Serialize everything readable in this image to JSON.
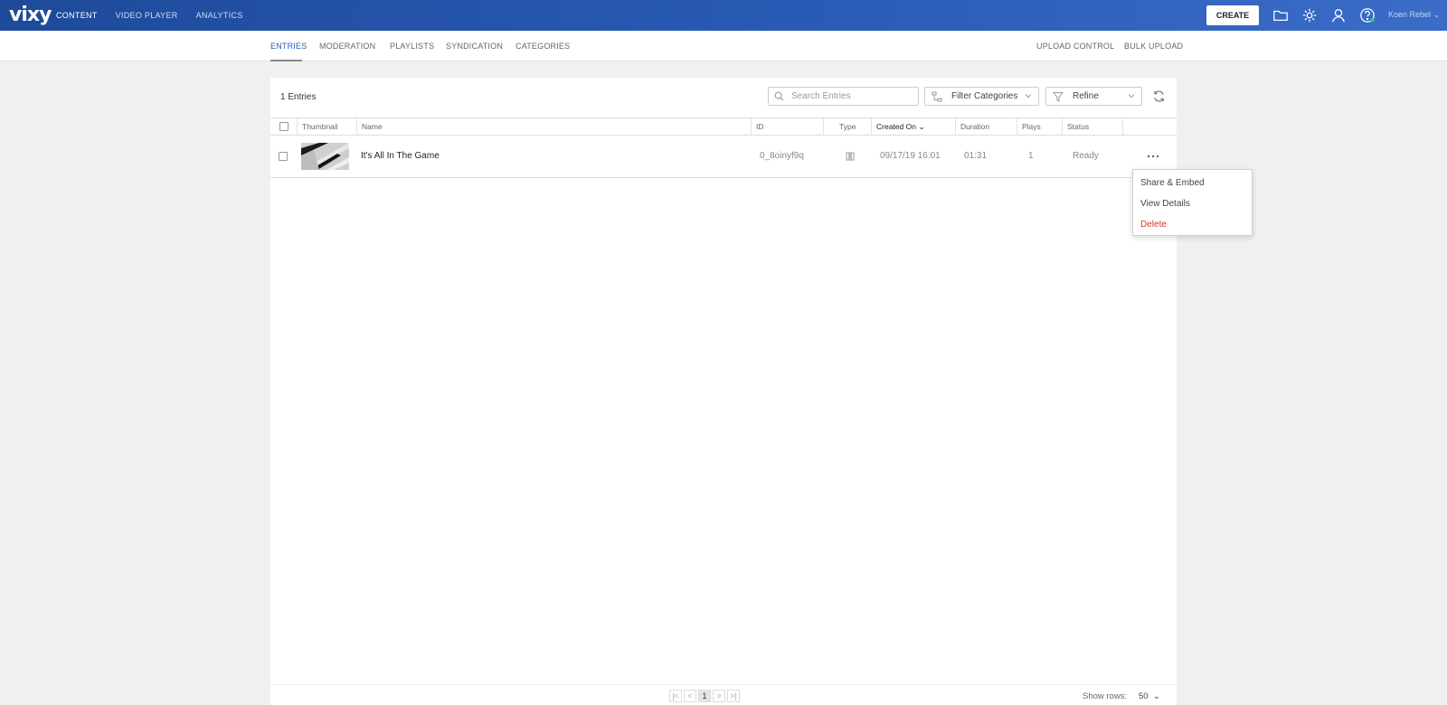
{
  "app": {
    "logo": "vixy"
  },
  "topnav": {
    "items": [
      {
        "label": "CONTENT",
        "active": true
      },
      {
        "label": "VIDEO PLAYER",
        "active": false
      },
      {
        "label": "ANALYTICS",
        "active": false
      }
    ]
  },
  "header": {
    "create_label": "CREATE",
    "user_name": "Koen Rebel"
  },
  "subnav": {
    "left": [
      "ENTRIES",
      "MODERATION",
      "PLAYLISTS",
      "SYNDICATION",
      "CATEGORIES"
    ],
    "right": [
      "UPLOAD CONTROL",
      "BULK UPLOAD"
    ]
  },
  "toolbar": {
    "entries_count": "1 Entries",
    "search_placeholder": "Search Entries",
    "filter_categories": "Filter Categories",
    "refine": "Refine"
  },
  "table": {
    "columns": [
      "Thumbnail",
      "Name",
      "ID",
      "Type",
      "Created On",
      "Duration",
      "Plays",
      "Status"
    ],
    "rows": [
      {
        "name": "It's All In The Game",
        "id": "0_8oinyf9q",
        "created_on": "09/17/19 16:01",
        "duration": "01:31",
        "plays": "1",
        "status": "Ready"
      }
    ]
  },
  "row_menu": {
    "items": [
      "Share & Embed",
      "View Details",
      "Delete"
    ]
  },
  "footer": {
    "page": "1",
    "show_rows_label": "Show rows:",
    "show_rows_value": "50"
  },
  "colors": {
    "topbar": "#2a5cb8",
    "accent": "#2a5cb8",
    "danger": "#d9342b",
    "status_dot": "#2ecc71"
  }
}
